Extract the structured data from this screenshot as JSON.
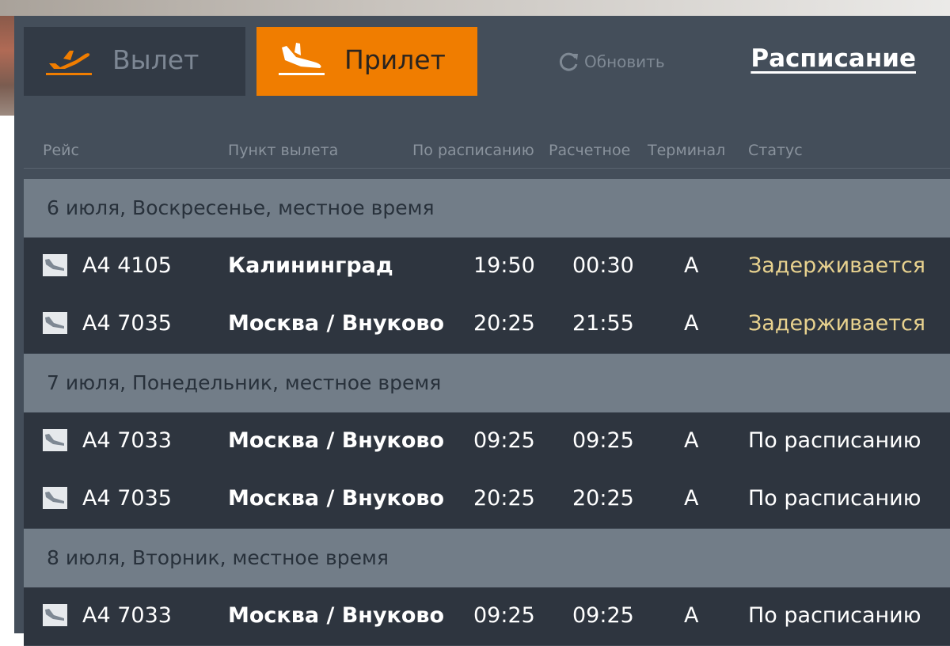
{
  "tabs": {
    "departure": {
      "label": "Вылет",
      "icon": "departure-plane-icon"
    },
    "arrival": {
      "label": "Прилет",
      "icon": "arrival-plane-icon"
    }
  },
  "refresh": {
    "label": "Обновить",
    "icon": "refresh-icon"
  },
  "schedule_link": "Расписание",
  "columns": {
    "flight": "Рейс",
    "origin": "Пункт вылета",
    "scheduled": "По расписанию",
    "estimated": "Расчетное",
    "terminal": "Терминал",
    "status": "Статус"
  },
  "colors": {
    "accent": "#f07d00",
    "board": "#444e5a",
    "row": "#2e353f",
    "date_row": "#727d88",
    "delayed": "#e8d28f"
  },
  "days": [
    {
      "date_label": "6 июля, Воскресенье, местное время",
      "flights": [
        {
          "icon": "arrival-plane-icon",
          "flight": "A4 4105",
          "origin": "Калининград",
          "scheduled": "19:50",
          "estimated": "00:30",
          "terminal": "A",
          "status": "Задерживается",
          "status_kind": "delayed"
        },
        {
          "icon": "arrival-plane-icon",
          "flight": "A4 7035",
          "origin": "Москва / Внуково",
          "scheduled": "20:25",
          "estimated": "21:55",
          "terminal": "A",
          "status": "Задерживается",
          "status_kind": "delayed"
        }
      ]
    },
    {
      "date_label": "7 июля, Понедельник, местное время",
      "flights": [
        {
          "icon": "arrival-plane-icon",
          "flight": "A4 7033",
          "origin": "Москва / Внуково",
          "scheduled": "09:25",
          "estimated": "09:25",
          "terminal": "A",
          "status": "По расписанию",
          "status_kind": "ok"
        },
        {
          "icon": "arrival-plane-icon",
          "flight": "A4 7035",
          "origin": "Москва / Внуково",
          "scheduled": "20:25",
          "estimated": "20:25",
          "terminal": "A",
          "status": "По расписанию",
          "status_kind": "ok"
        }
      ]
    },
    {
      "date_label": "8 июля, Вторник, местное время",
      "flights": [
        {
          "icon": "arrival-plane-icon",
          "flight": "A4 7033",
          "origin": "Москва / Внуково",
          "scheduled": "09:25",
          "estimated": "09:25",
          "terminal": "A",
          "status": "По расписанию",
          "status_kind": "ok"
        }
      ]
    }
  ]
}
